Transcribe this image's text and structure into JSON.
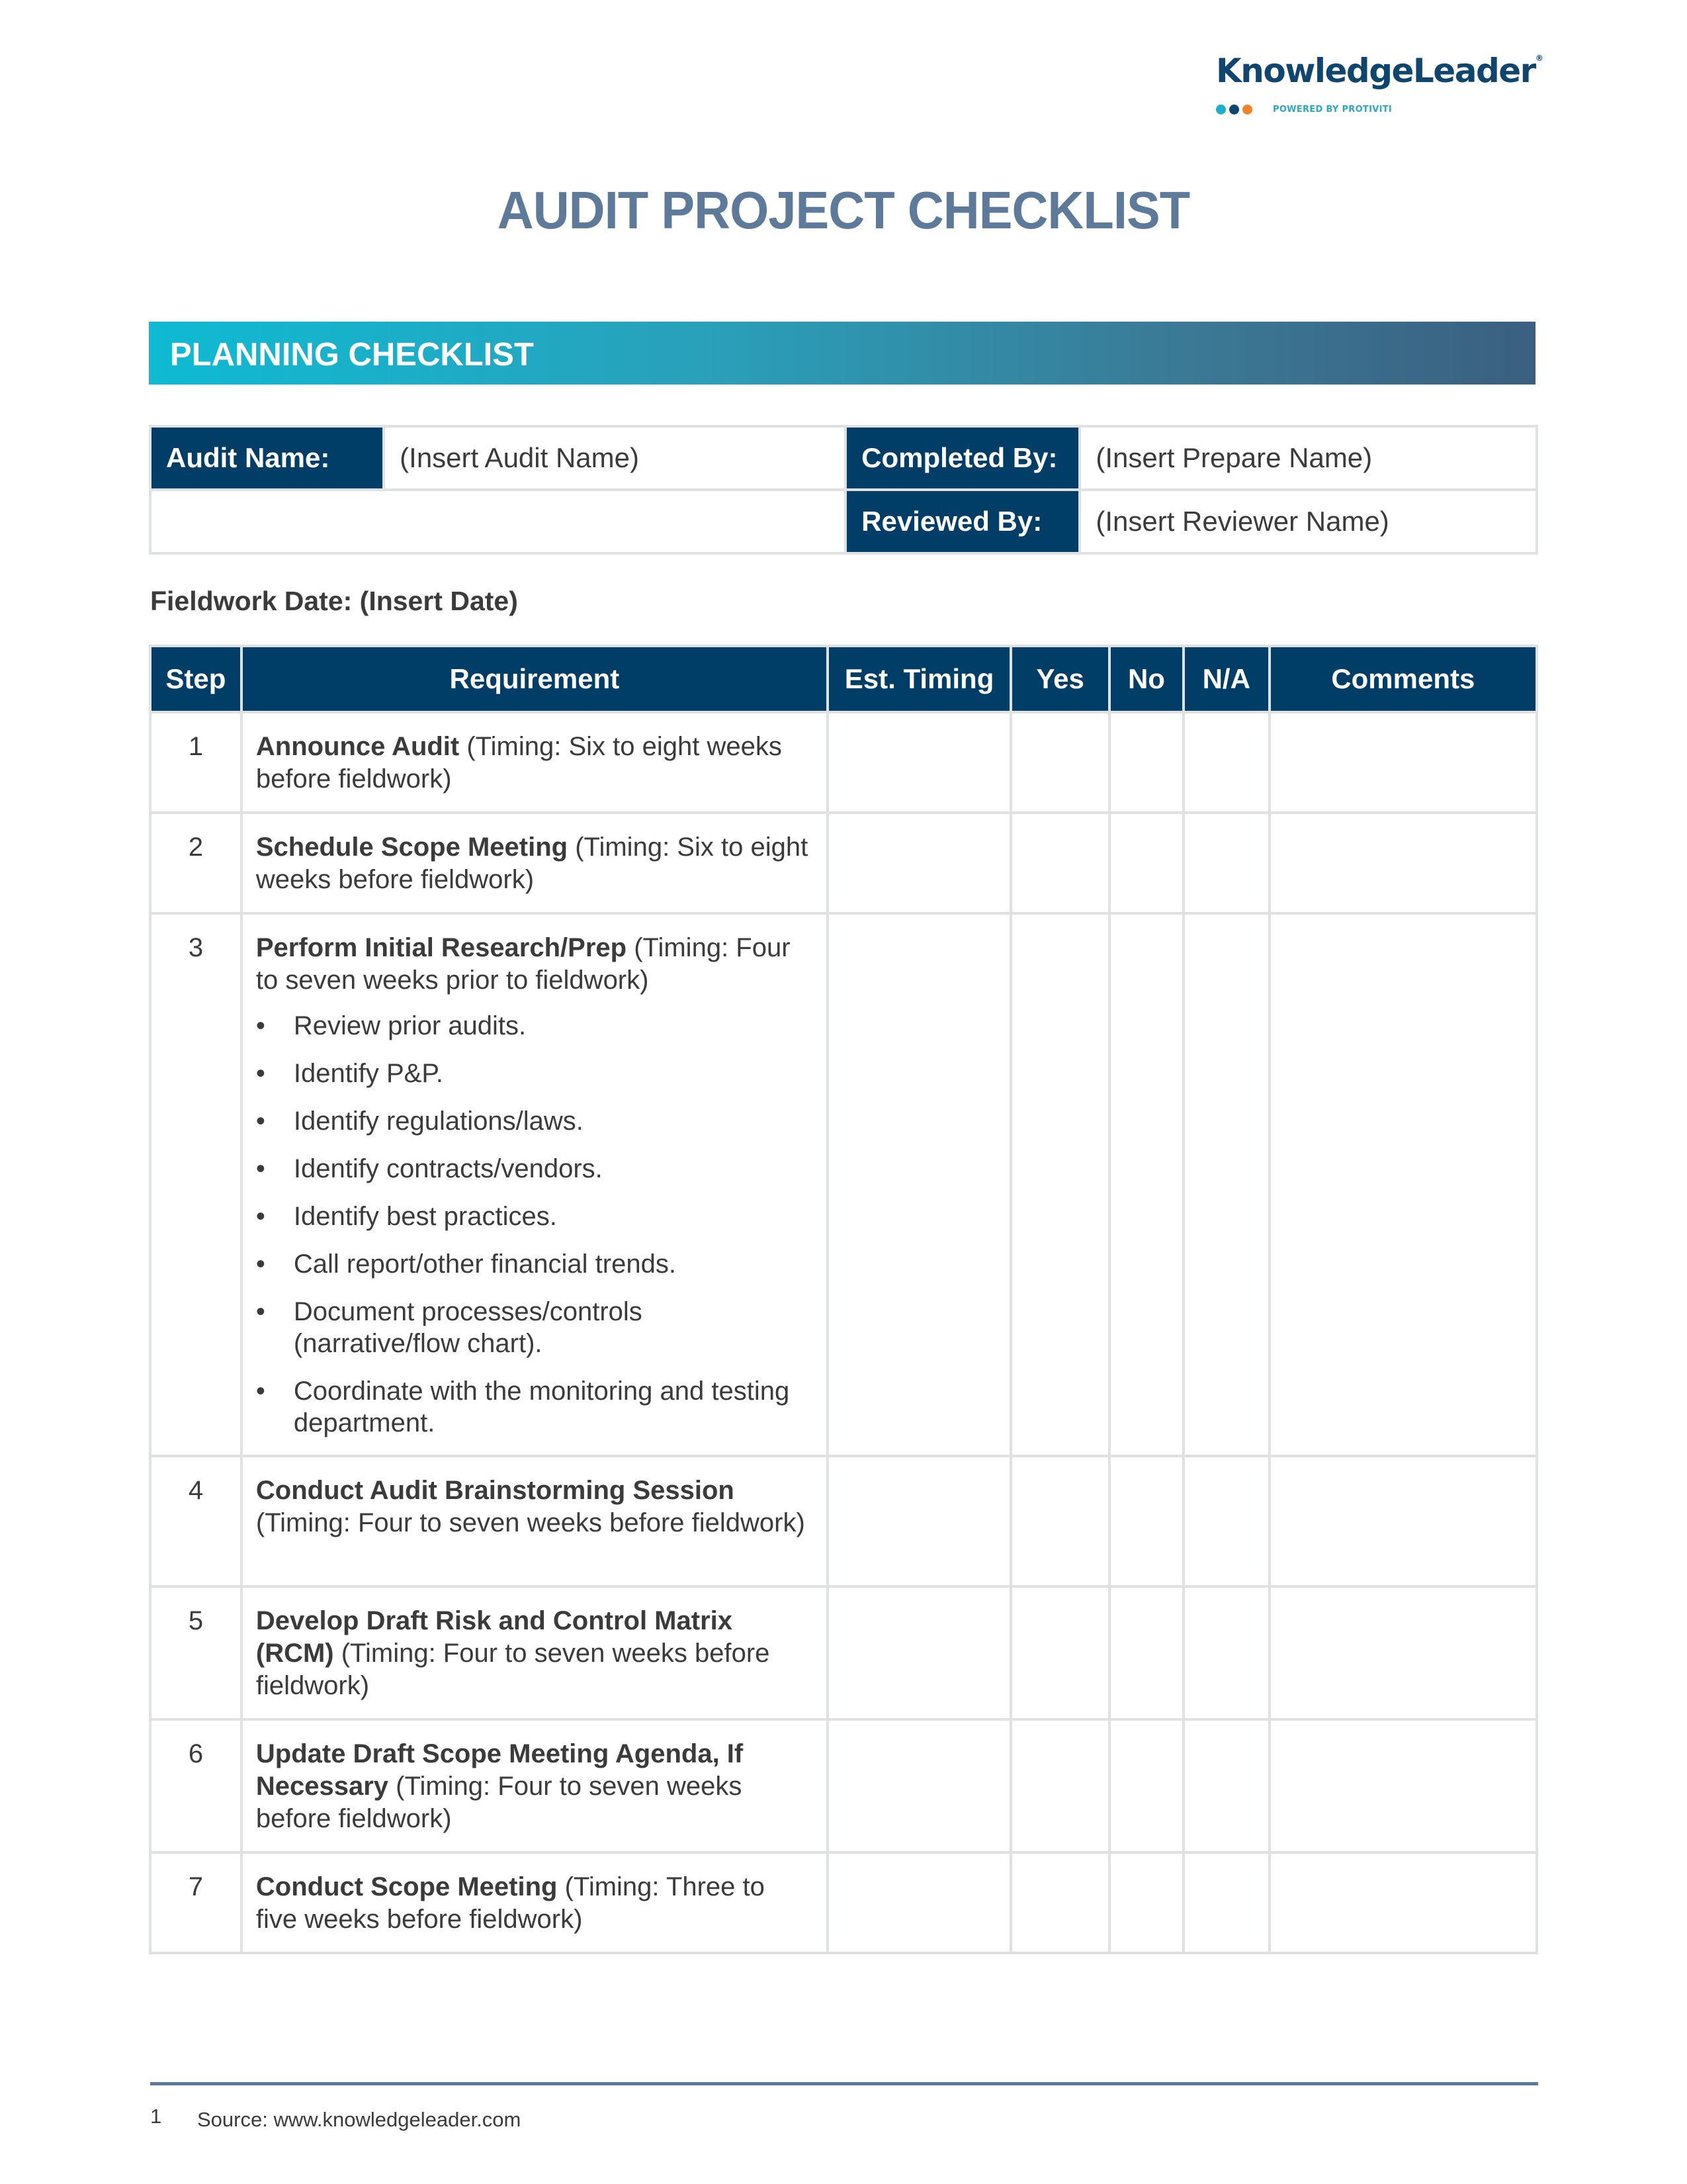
{
  "logo": {
    "brand": "KnowledgeLeader",
    "registered_mark": "®",
    "tagline": "POWERED BY PROTIVITI",
    "dot_colors": [
      "#1ab0cc",
      "#0f4670",
      "#f0832a"
    ]
  },
  "title": "AUDIT PROJECT CHECKLIST",
  "section": {
    "title": "PLANNING CHECKLIST"
  },
  "info": {
    "audit_name_label": "Audit Name:",
    "audit_name_value": "(Insert Audit Name)",
    "completed_by_label": "Completed By:",
    "completed_by_value": "(Insert Prepare Name)",
    "reviewed_by_label": "Reviewed By:",
    "reviewed_by_value": "(Insert Reviewer Name)"
  },
  "fieldwork_date": "Fieldwork Date: (Insert Date)",
  "checklist": {
    "headers": [
      "Step",
      "Requirement",
      "Est. Timing",
      "Yes",
      "No",
      "N/A",
      "Comments"
    ],
    "rows": [
      {
        "step": "1",
        "title": "Announce Audit",
        "timing": " (Timing: Six to eight weeks before fieldwork)",
        "bullets": []
      },
      {
        "step": "2",
        "title": "Schedule Scope Meeting",
        "timing": " (Timing: Six to eight weeks before fieldwork)",
        "bullets": []
      },
      {
        "step": "3",
        "title": "Perform Initial Research/Prep",
        "timing": " (Timing: Four to seven weeks prior to fieldwork)",
        "bullets": [
          "Review prior audits.",
          "Identify P&P.",
          "Identify regulations/laws.",
          "Identify contracts/vendors.",
          "Identify best practices.",
          "Call report/other financial trends.",
          "Document processes/controls (narrative/flow chart).",
          "Coordinate with the monitoring and testing department."
        ]
      },
      {
        "step": "4",
        "title": "Conduct Audit Brainstorming Session",
        "timing": " (Timing: Four to seven weeks before fieldwork)",
        "bullets": []
      },
      {
        "step": "5",
        "title": "Develop Draft Risk and Control Matrix (RCM)",
        "timing": " (Timing: Four to seven weeks before fieldwork)",
        "bullets": []
      },
      {
        "step": "6",
        "title": "Update Draft Scope Meeting Agenda, If Necessary",
        "timing": " (Timing: Four to seven weeks before fieldwork)",
        "bullets": []
      },
      {
        "step": "7",
        "title": "Conduct Scope Meeting",
        "timing": " (Timing: Three to five weeks before fieldwork)",
        "bullets": []
      }
    ]
  },
  "footer": {
    "page_number": "1",
    "source": "Source: www.knowledgeleader.com"
  }
}
